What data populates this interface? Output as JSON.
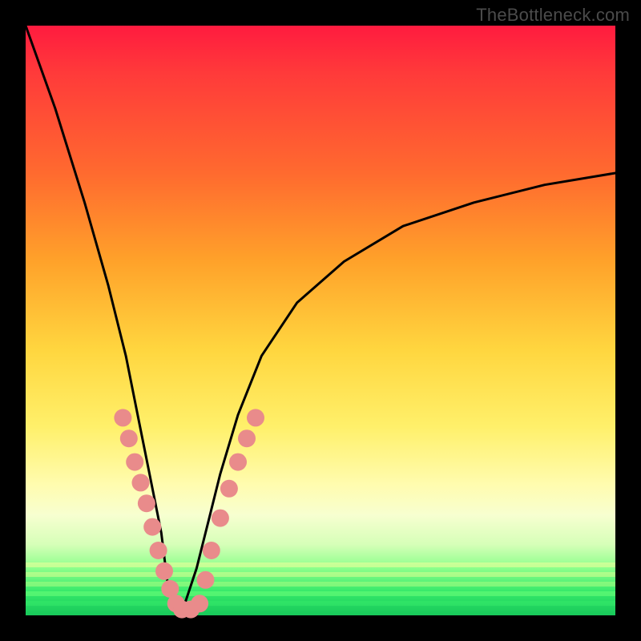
{
  "watermark": "TheBottleneck.com",
  "chart_data": {
    "type": "line",
    "title": "",
    "xlabel": "",
    "ylabel": "",
    "xlim": [
      0,
      1
    ],
    "ylim": [
      0,
      1
    ],
    "series": [
      {
        "name": "bottleneck-curve",
        "x": [
          0.0,
          0.05,
          0.1,
          0.14,
          0.17,
          0.19,
          0.21,
          0.23,
          0.24,
          0.25,
          0.26,
          0.27,
          0.29,
          0.31,
          0.33,
          0.36,
          0.4,
          0.46,
          0.54,
          0.64,
          0.76,
          0.88,
          1.0
        ],
        "values": [
          1.0,
          0.86,
          0.7,
          0.56,
          0.44,
          0.34,
          0.24,
          0.14,
          0.06,
          0.02,
          0.0,
          0.02,
          0.08,
          0.16,
          0.24,
          0.34,
          0.44,
          0.53,
          0.6,
          0.66,
          0.7,
          0.73,
          0.75
        ]
      }
    ],
    "markers": {
      "name": "sample-points",
      "color": "#e98b8b",
      "points": [
        {
          "x": 0.165,
          "y": 0.335
        },
        {
          "x": 0.175,
          "y": 0.3
        },
        {
          "x": 0.185,
          "y": 0.26
        },
        {
          "x": 0.195,
          "y": 0.225
        },
        {
          "x": 0.205,
          "y": 0.19
        },
        {
          "x": 0.215,
          "y": 0.15
        },
        {
          "x": 0.225,
          "y": 0.11
        },
        {
          "x": 0.235,
          "y": 0.075
        },
        {
          "x": 0.245,
          "y": 0.045
        },
        {
          "x": 0.255,
          "y": 0.02
        },
        {
          "x": 0.265,
          "y": 0.01
        },
        {
          "x": 0.28,
          "y": 0.01
        },
        {
          "x": 0.295,
          "y": 0.02
        },
        {
          "x": 0.305,
          "y": 0.06
        },
        {
          "x": 0.315,
          "y": 0.11
        },
        {
          "x": 0.33,
          "y": 0.165
        },
        {
          "x": 0.345,
          "y": 0.215
        },
        {
          "x": 0.36,
          "y": 0.26
        },
        {
          "x": 0.375,
          "y": 0.3
        },
        {
          "x": 0.39,
          "y": 0.335
        }
      ]
    }
  }
}
